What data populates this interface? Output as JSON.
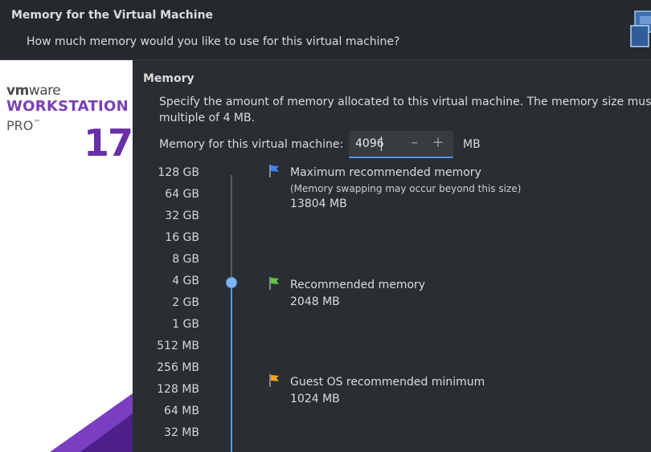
{
  "header": {
    "title": "Memory for the Virtual Machine",
    "subtitle": "How much memory would you like to use for this virtual machine?"
  },
  "brand": {
    "vendor_a": "vm",
    "vendor_b": "ware",
    "product": "WORKSTATION",
    "edition": "PRO",
    "tm": "™",
    "version": "17"
  },
  "memory": {
    "section_title": "Memory",
    "description_line1": "Specify the amount of memory allocated to this virtual machine. The memory size must b",
    "description_line2": "multiple of 4 MB.",
    "field_label": "Memory for this virtual machine:",
    "value": "4096",
    "unit": "MB",
    "decrement_symbol": "–",
    "increment_symbol": "+"
  },
  "scale": {
    "labels": [
      "128 GB",
      "64 GB",
      "32 GB",
      "16 GB",
      "8 GB",
      "4 GB",
      "2 GB",
      "1 GB",
      "512 MB",
      "256 MB",
      "128 MB",
      "64 MB",
      "32 MB"
    ],
    "selected": "4 GB"
  },
  "markers": {
    "max": {
      "title": "Maximum recommended memory",
      "note": "(Memory swapping may occur beyond this size)",
      "value": "13804 MB",
      "color": "#3b82f6"
    },
    "recommended": {
      "title": "Recommended memory",
      "value": "2048 MB",
      "color": "#5cc93c"
    },
    "minimum": {
      "title": "Guest OS recommended minimum",
      "value": "1024 MB",
      "color": "#f0a020"
    }
  },
  "colors": {
    "accent": "#4f9be9",
    "brand_purple": "#7b3fb5",
    "background": "#2a2d31"
  }
}
